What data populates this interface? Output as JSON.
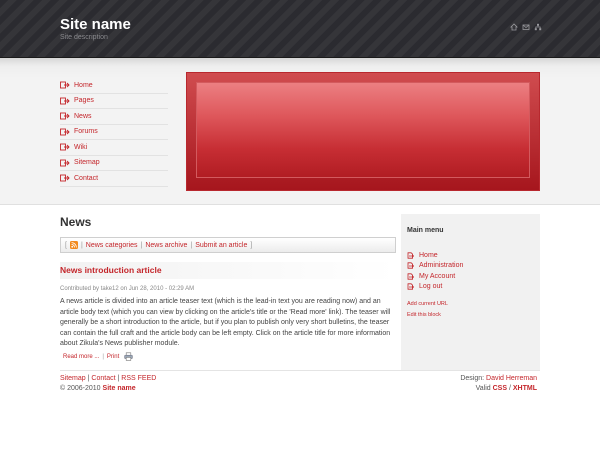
{
  "header": {
    "site_name": "Site name",
    "site_description": "Site description",
    "icons": [
      "home-icon",
      "sitemap-icon",
      "network-icon"
    ]
  },
  "nav": {
    "items": [
      {
        "label": "Home"
      },
      {
        "label": "Pages"
      },
      {
        "label": "News"
      },
      {
        "label": "Forums"
      },
      {
        "label": "Wiki"
      },
      {
        "label": "Sitemap"
      },
      {
        "label": "Contact"
      }
    ]
  },
  "main": {
    "title": "News",
    "bar": {
      "open": "[",
      "sep1": "|",
      "categories": "News categories",
      "sep2": "|",
      "archive": "News archive",
      "sep3": "|",
      "submit": "Submit an article",
      "close": "]"
    },
    "article": {
      "title": "News introduction article",
      "byline": "Contributed by take12 on Jun 28, 2010 - 02:29 AM",
      "body": "A news article is divided into an article teaser text (which is the lead-in text you are reading now) and an article body text (which you can view by clicking on the article's title or the 'Read more' link). The teaser will generally be a short introduction to the article, but if you plan to publish only very short bulletins, the teaser can contain the full craft and the article body can be left empty. Click on the article title for more information about Zikula's News publisher module.",
      "read_more": "Read more ...",
      "sep": "|",
      "print": "Print"
    }
  },
  "sidebar": {
    "title": "Main menu",
    "items": [
      {
        "label": "Home"
      },
      {
        "label": "Administration"
      },
      {
        "label": "My Account"
      },
      {
        "label": "Log out"
      }
    ],
    "add_url": "Add current URL",
    "edit_block": "Edit this block"
  },
  "footer": {
    "sitemap": "Sitemap",
    "sep1": "|",
    "contact": "Contact",
    "sep2": "|",
    "rss": "RSS FEED",
    "copyright": "© 2006-2010",
    "site_name": "Site name",
    "design_label": "Design:",
    "designer": "David Herreman",
    "valid_label": "Valid",
    "css": "CSS",
    "sep3": "/",
    "xhtml": "XHTML"
  },
  "colors": {
    "accent": "#c4262b",
    "header_bg": "#2b2b30",
    "banner": "#c72e34"
  }
}
